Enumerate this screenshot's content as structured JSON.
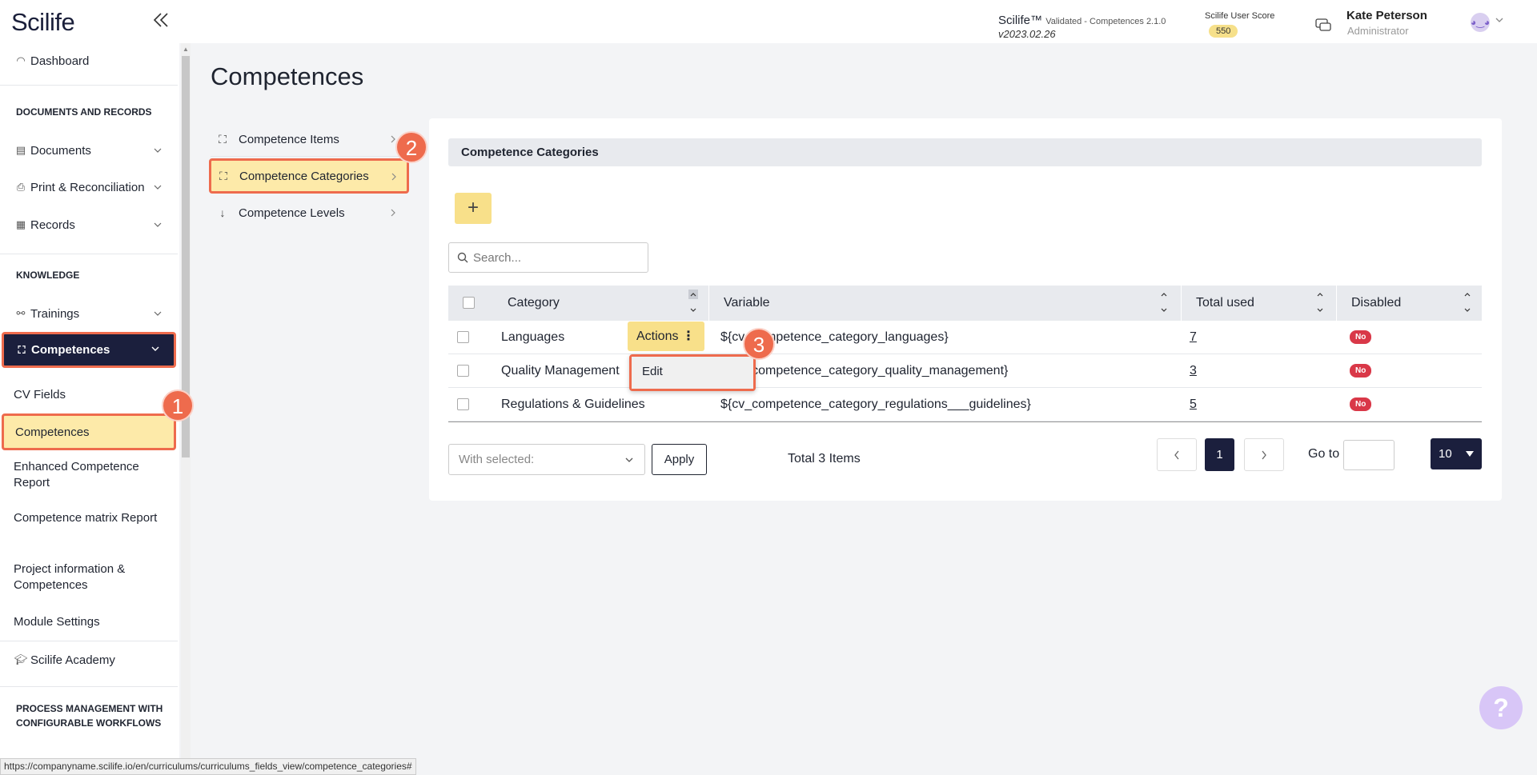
{
  "header": {
    "logo": "Scilife",
    "product": "Scilife™",
    "product_sub": "Validated - Competences 2.1.0",
    "version": "v2023.02.26",
    "score_label": "Scilife User Score",
    "score_value": "550",
    "user_name": "Kate Peterson",
    "user_role": "Administrator"
  },
  "sidebar": {
    "dashboard": "Dashboard",
    "section_docs": "DOCUMENTS AND RECORDS",
    "documents": "Documents",
    "print": "Print & Reconciliation",
    "records": "Records",
    "section_knowledge": "KNOWLEDGE",
    "trainings": "Trainings",
    "competences": "Competences",
    "cv_fields": "CV Fields",
    "competences_sub": "Competences",
    "enhanced": "Enhanced Competence Report",
    "matrix": "Competence matrix Report",
    "project": "Project information & Competences",
    "module_settings": "Module Settings",
    "academy": "Scilife Academy",
    "section_process": "PROCESS MANAGEMENT WITH CONFIGURABLE WORKFLOWS"
  },
  "steps": [
    "1",
    "2",
    "3"
  ],
  "page": {
    "title": "Competences",
    "subnav": [
      "Competence Items",
      "Competence Categories",
      "Competence Levels"
    ],
    "panel_title": "Competence Categories",
    "add_symbol": "+",
    "search_placeholder": "Search..."
  },
  "table": {
    "headers": [
      "Category",
      "Variable",
      "Total used",
      "Disabled"
    ],
    "rows": [
      {
        "category": "Languages",
        "variable": "${cv_competence_category_languages}",
        "total": "7",
        "disabled": "No"
      },
      {
        "category": "Quality Management",
        "variable": "${cv_competence_category_quality_management}",
        "total": "3",
        "disabled": "No"
      },
      {
        "category": "Regulations & Guidelines",
        "variable": "${cv_competence_category_regulations___guidelines}",
        "total": "5",
        "disabled": "No"
      }
    ],
    "actions_label": "Actions",
    "dropdown_edit": "Edit"
  },
  "footer": {
    "with_selected": "With selected:",
    "apply": "Apply",
    "total": "Total 3 Items",
    "current_page": "1",
    "goto_label": "Go to",
    "page_size": "10"
  },
  "status_url": "https://companyname.scilife.io/en/curriculums/curriculums_fields_view/competence_categories#",
  "help_symbol": "?"
}
